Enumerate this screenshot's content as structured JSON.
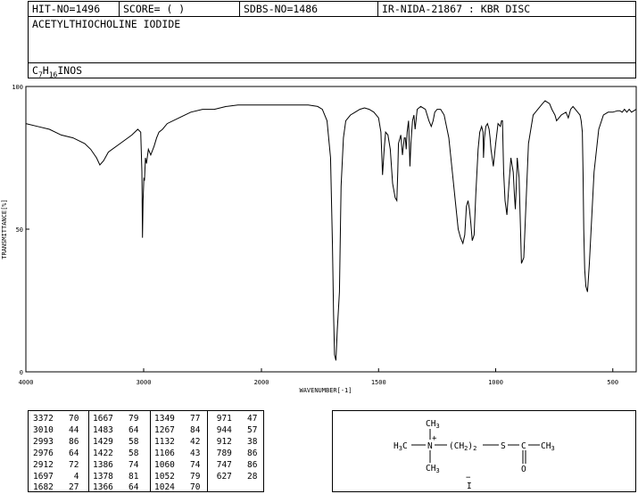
{
  "header": {
    "hit_no": "HIT-NO=1496",
    "score": "SCORE=  (   )",
    "sdbs_no": "SDBS-NO=1486",
    "ir_method": "IR-NIDA-21867 : KBR DISC",
    "compound_name": "ACETYLTHIOCHOLINE IODIDE",
    "formula": {
      "c": "C",
      "c_n": "7",
      "h": "H",
      "h_n": "16",
      "rest": "INOS"
    }
  },
  "chart_data": {
    "type": "line",
    "xlabel": "WAVENUMBER[-1]",
    "ylabel": "TRANSMITTANCE[%]",
    "xlim": [
      4000,
      400
    ],
    "ylim": [
      0,
      100
    ],
    "x_ticks": [
      "4000",
      "3000",
      "2000",
      "1500",
      "1000",
      "500"
    ],
    "x_tick_values": [
      4000,
      3000,
      2000,
      1500,
      1000,
      500
    ],
    "y_ticks": [
      "100",
      "50",
      "0"
    ],
    "y_tick_values": [
      100,
      50,
      0
    ],
    "grid": false,
    "series": [
      {
        "x": [
          4000,
          3900,
          3800,
          3700,
          3600,
          3500,
          3450,
          3400,
          3372,
          3340,
          3300,
          3200,
          3100,
          3050,
          3025,
          3015,
          3010,
          3005,
          2998,
          2993,
          2985,
          2976,
          2960,
          2940,
          2912,
          2890,
          2870,
          2840,
          2800,
          2700,
          2600,
          2500,
          2400,
          2300,
          2200,
          2100,
          2000,
          1900,
          1800,
          1760,
          1740,
          1720,
          1705,
          1697,
          1692,
          1688,
          1682,
          1676,
          1667,
          1660,
          1650,
          1640,
          1620,
          1600,
          1580,
          1560,
          1540,
          1520,
          1500,
          1490,
          1483,
          1476,
          1470,
          1460,
          1450,
          1440,
          1429,
          1422,
          1418,
          1415,
          1405,
          1398,
          1390,
          1386,
          1382,
          1378,
          1372,
          1366,
          1362,
          1355,
          1349,
          1344,
          1335,
          1320,
          1300,
          1285,
          1275,
          1267,
          1260,
          1250,
          1235,
          1220,
          1200,
          1185,
          1170,
          1160,
          1150,
          1140,
          1132,
          1125,
          1118,
          1112,
          1106,
          1100,
          1092,
          1085,
          1075,
          1068,
          1060,
          1054,
          1052,
          1048,
          1042,
          1035,
          1028,
          1024,
          1020,
          1010,
          1000,
          990,
          980,
          975,
          971,
          966,
          960,
          952,
          944,
          935,
          925,
          920,
          916,
          912,
          908,
          900,
          890,
          880,
          860,
          840,
          820,
          800,
          789,
          780,
          770,
          760,
          747,
          740,
          720,
          700,
          690,
          680,
          670,
          660,
          650,
          640,
          635,
          630,
          627,
          624,
          620,
          615,
          608,
          600,
          580,
          560,
          540,
          520,
          500,
          480,
          470,
          460,
          450,
          440,
          430,
          420,
          410,
          400
        ],
        "y": [
          87,
          86,
          85,
          83,
          82,
          80,
          78,
          75,
          72.5,
          74,
          77,
          80,
          83,
          85,
          84,
          70,
          47,
          60,
          68,
          67,
          75,
          73,
          78,
          76,
          79,
          82,
          84,
          85,
          87,
          89,
          91,
          92,
          92,
          93,
          93.5,
          93.5,
          93.5,
          93.5,
          93.5,
          93,
          92,
          88,
          75,
          45,
          20,
          6,
          4,
          15,
          28,
          65,
          82,
          88,
          90,
          91,
          92,
          92.5,
          92,
          91,
          89,
          84,
          69,
          78,
          84,
          83,
          78,
          66,
          61,
          60,
          70,
          80,
          83,
          76,
          82,
          82,
          78,
          84,
          88,
          72,
          80,
          88,
          90,
          85,
          92,
          93,
          92,
          88,
          86,
          88,
          91,
          92,
          92,
          90,
          82,
          70,
          58,
          50,
          47,
          45,
          48,
          58,
          60,
          57,
          52,
          46,
          48,
          62,
          78,
          84,
          86,
          84,
          75,
          82,
          86,
          87,
          85,
          82,
          78,
          72,
          80,
          87,
          86,
          88,
          88,
          70,
          60,
          55,
          65,
          75,
          70,
          62,
          57,
          65,
          75,
          68,
          38,
          40,
          80,
          90,
          92,
          94,
          95,
          94.5,
          94,
          92,
          90,
          88,
          90,
          91,
          89,
          92,
          93,
          92,
          91,
          90,
          88,
          84,
          70,
          50,
          36,
          30,
          28,
          38,
          70,
          85,
          90,
          91,
          91,
          91.5,
          91.5,
          91,
          92,
          91,
          92,
          91,
          91.5,
          92
        ]
      }
    ]
  },
  "peak_table": [
    {
      "wn": "3372",
      "t": "70"
    },
    {
      "wn": "3010",
      "t": "44"
    },
    {
      "wn": "2993",
      "t": "86"
    },
    {
      "wn": "2976",
      "t": "64"
    },
    {
      "wn": "2912",
      "t": "72"
    },
    {
      "wn": "1697",
      "t": "4"
    },
    {
      "wn": "1682",
      "t": "27"
    },
    {
      "wn": "1667",
      "t": "79"
    },
    {
      "wn": "1483",
      "t": "64"
    },
    {
      "wn": "1429",
      "t": "58"
    },
    {
      "wn": "1422",
      "t": "58"
    },
    {
      "wn": "1386",
      "t": "74"
    },
    {
      "wn": "1378",
      "t": "81"
    },
    {
      "wn": "1366",
      "t": "64"
    },
    {
      "wn": "1349",
      "t": "77"
    },
    {
      "wn": "1267",
      "t": "84"
    },
    {
      "wn": "1132",
      "t": "42"
    },
    {
      "wn": "1106",
      "t": "43"
    },
    {
      "wn": "1060",
      "t": "74"
    },
    {
      "wn": "1052",
      "t": "79"
    },
    {
      "wn": "1024",
      "t": "70"
    },
    {
      "wn": "971",
      "t": "47"
    },
    {
      "wn": "944",
      "t": "57"
    },
    {
      "wn": "912",
      "t": "38"
    },
    {
      "wn": "789",
      "t": "86"
    },
    {
      "wn": "747",
      "t": "86"
    },
    {
      "wn": "627",
      "t": "28"
    }
  ],
  "structure": {
    "ch3_top": "CH",
    "ch3_top_sub": "3",
    "plus": "+",
    "h3c_left": "H",
    "h3c_left_sub": "3",
    "h3c_left_c": "C",
    "n": "N",
    "chain": "(CH",
    "chain_sub2": "2",
    "chain_close": ")",
    "chain_sub_n": "2",
    "s": "S",
    "c": "C",
    "ch3_right": "CH",
    "ch3_right_sub": "3",
    "ch3_bottom": "CH",
    "ch3_bottom_sub": "3",
    "o": "O",
    "minus": "−",
    "i": "I"
  }
}
